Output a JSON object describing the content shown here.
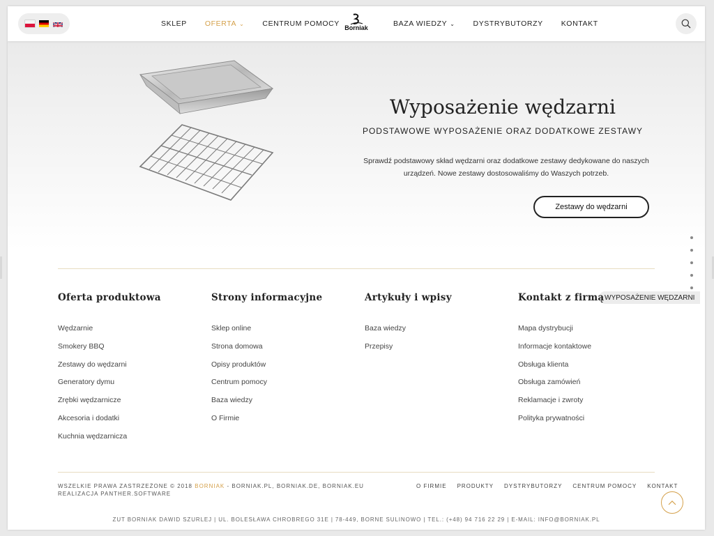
{
  "header": {
    "languages": [
      "pl",
      "de",
      "en"
    ],
    "nav_left": [
      {
        "label": "SKLEP",
        "active": false,
        "dropdown": false
      },
      {
        "label": "OFERTA",
        "active": true,
        "dropdown": true
      },
      {
        "label": "CENTRUM POMOCY",
        "active": false,
        "dropdown": false
      }
    ],
    "nav_right": [
      {
        "label": "BAZA WIEDZY",
        "active": false,
        "dropdown": true
      },
      {
        "label": "DYSTRYBUTORZY",
        "active": false,
        "dropdown": false
      },
      {
        "label": "KONTAKT",
        "active": false,
        "dropdown": false
      }
    ],
    "logo_text": "Borniak"
  },
  "hero": {
    "title": "Wyposażenie wędzarni",
    "subtitle": "PODSTAWOWE WYPOSAŻENIE ORAZ DODATKOWE ZESTAWY",
    "description": "Sprawdź podstawowy skład wędzarni oraz dodatkowe zestawy dedykowane do naszych urządzeń. Nowe zestawy dostosowaliśmy do Waszych potrzeb.",
    "button_label": "Zestawy do wędzarni"
  },
  "section_nav": {
    "dot_count": 6,
    "active_index": 5,
    "active_label": "WYPOSAŻENIE WĘDZARNI"
  },
  "footer": {
    "columns": [
      {
        "title": "Oferta produktowa",
        "items": [
          "Wędzarnie",
          "Smokery BBQ",
          "Zestawy do wędzarni",
          "Generatory dymu",
          "Zrębki wędzarnicze",
          "Akcesoria i dodatki",
          "Kuchnia wędzarnicza"
        ]
      },
      {
        "title": "Strony informacyjne",
        "items": [
          "Sklep online",
          "Strona domowa",
          "Opisy produktów",
          "Centrum pomocy",
          "Baza wiedzy",
          "O Firmie"
        ]
      },
      {
        "title": "Artykuły i wpisy",
        "items": [
          "Baza wiedzy",
          "Przepisy"
        ]
      },
      {
        "title": "Kontakt z firmą",
        "items": [
          "Mapa dystrybucji",
          "Informacje kontaktowe",
          "Obsługa klienta",
          "Obsługa zamówień",
          "Reklamacje i zwroty",
          "Polityka prywatności"
        ]
      }
    ],
    "copyright_prefix": "WSZELKIE PRAWA ZASTRZEŻONE © 2018 ",
    "copyright_brand": "BORNIAK",
    "copyright_suffix": " - BORNIAK.PL, BORNIAK.DE, BORNIAK.EU",
    "realization": "REALIZACJA PANTHER.SOFTWARE",
    "bottom_nav": [
      "O FIRMIE",
      "PRODUKTY",
      "DYSTRYBUTORZY",
      "CENTRUM POMOCY",
      "KONTAKT"
    ],
    "address": "ZUT BORNIAK DAWID SZURLEJ | UL. BOLESŁAWA CHROBREGO 31E | 78-449, BORNE SULINOWO | TEL.: (+48) 94 716 22 29 | E-MAIL: INFO@BORNIAK.PL"
  },
  "colors": {
    "accent": "#d4a04a",
    "rule": "#e8dcc0"
  }
}
